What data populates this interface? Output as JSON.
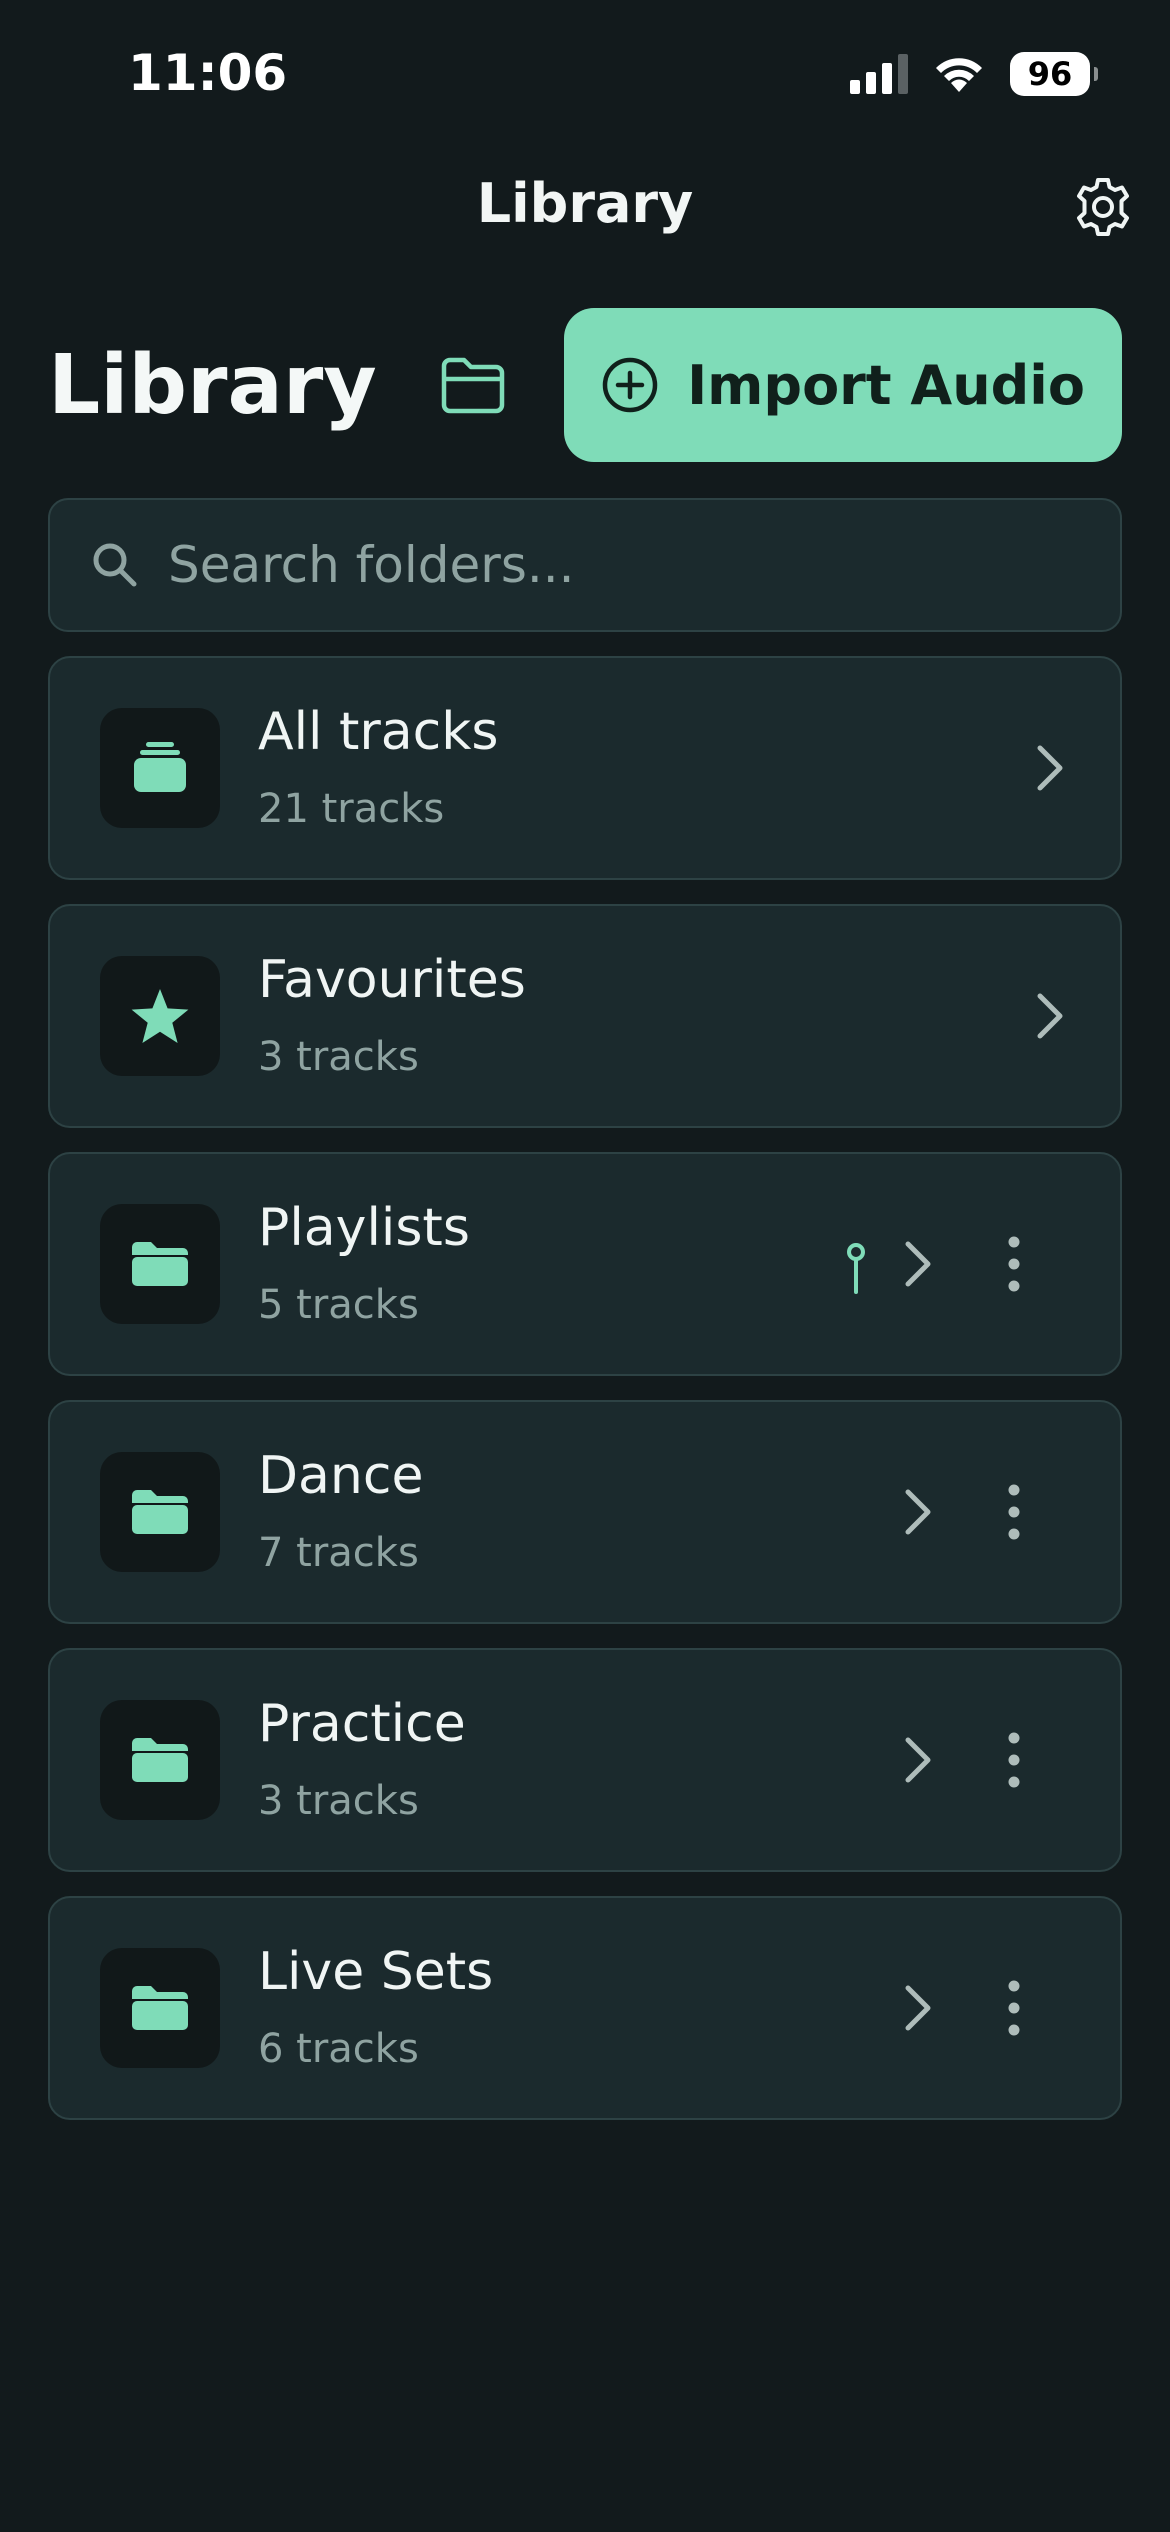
{
  "status_bar": {
    "time": "11:06",
    "battery": "96"
  },
  "nav": {
    "title": "Library"
  },
  "header": {
    "title": "Library",
    "import_label": "Import Audio"
  },
  "search": {
    "placeholder": "Search folders..."
  },
  "folders": [
    {
      "name": "All tracks",
      "count": "21 tracks",
      "icon": "stack-icon"
    },
    {
      "name": "Favourites",
      "count": "3 tracks",
      "icon": "star-icon"
    },
    {
      "name": "Playlists",
      "count": "5 tracks",
      "icon": "folder-icon",
      "pinned": true
    },
    {
      "name": "Dance",
      "count": "7 tracks",
      "icon": "folder-icon"
    },
    {
      "name": "Practice",
      "count": "3 tracks",
      "icon": "folder-icon"
    },
    {
      "name": "Live Sets",
      "count": "6 tracks",
      "icon": "folder-icon"
    }
  ],
  "colors": {
    "accent": "#7fdcb8",
    "background": "#121a1c",
    "card": "#1b2a2d",
    "card_border": "#2d4244",
    "secondary_text": "#8fa3a1"
  }
}
